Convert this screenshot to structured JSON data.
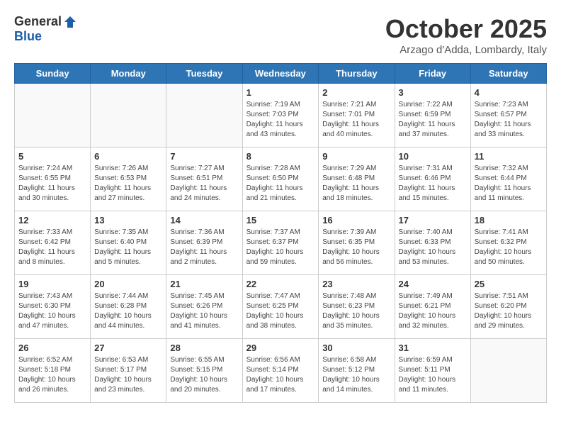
{
  "header": {
    "logo_general": "General",
    "logo_blue": "Blue",
    "month_title": "October 2025",
    "subtitle": "Arzago d'Adda, Lombardy, Italy"
  },
  "weekdays": [
    "Sunday",
    "Monday",
    "Tuesday",
    "Wednesday",
    "Thursday",
    "Friday",
    "Saturday"
  ],
  "weeks": [
    [
      {
        "day": "",
        "info": ""
      },
      {
        "day": "",
        "info": ""
      },
      {
        "day": "",
        "info": ""
      },
      {
        "day": "1",
        "info": "Sunrise: 7:19 AM\nSunset: 7:03 PM\nDaylight: 11 hours\nand 43 minutes."
      },
      {
        "day": "2",
        "info": "Sunrise: 7:21 AM\nSunset: 7:01 PM\nDaylight: 11 hours\nand 40 minutes."
      },
      {
        "day": "3",
        "info": "Sunrise: 7:22 AM\nSunset: 6:59 PM\nDaylight: 11 hours\nand 37 minutes."
      },
      {
        "day": "4",
        "info": "Sunrise: 7:23 AM\nSunset: 6:57 PM\nDaylight: 11 hours\nand 33 minutes."
      }
    ],
    [
      {
        "day": "5",
        "info": "Sunrise: 7:24 AM\nSunset: 6:55 PM\nDaylight: 11 hours\nand 30 minutes."
      },
      {
        "day": "6",
        "info": "Sunrise: 7:26 AM\nSunset: 6:53 PM\nDaylight: 11 hours\nand 27 minutes."
      },
      {
        "day": "7",
        "info": "Sunrise: 7:27 AM\nSunset: 6:51 PM\nDaylight: 11 hours\nand 24 minutes."
      },
      {
        "day": "8",
        "info": "Sunrise: 7:28 AM\nSunset: 6:50 PM\nDaylight: 11 hours\nand 21 minutes."
      },
      {
        "day": "9",
        "info": "Sunrise: 7:29 AM\nSunset: 6:48 PM\nDaylight: 11 hours\nand 18 minutes."
      },
      {
        "day": "10",
        "info": "Sunrise: 7:31 AM\nSunset: 6:46 PM\nDaylight: 11 hours\nand 15 minutes."
      },
      {
        "day": "11",
        "info": "Sunrise: 7:32 AM\nSunset: 6:44 PM\nDaylight: 11 hours\nand 11 minutes."
      }
    ],
    [
      {
        "day": "12",
        "info": "Sunrise: 7:33 AM\nSunset: 6:42 PM\nDaylight: 11 hours\nand 8 minutes."
      },
      {
        "day": "13",
        "info": "Sunrise: 7:35 AM\nSunset: 6:40 PM\nDaylight: 11 hours\nand 5 minutes."
      },
      {
        "day": "14",
        "info": "Sunrise: 7:36 AM\nSunset: 6:39 PM\nDaylight: 11 hours\nand 2 minutes."
      },
      {
        "day": "15",
        "info": "Sunrise: 7:37 AM\nSunset: 6:37 PM\nDaylight: 10 hours\nand 59 minutes."
      },
      {
        "day": "16",
        "info": "Sunrise: 7:39 AM\nSunset: 6:35 PM\nDaylight: 10 hours\nand 56 minutes."
      },
      {
        "day": "17",
        "info": "Sunrise: 7:40 AM\nSunset: 6:33 PM\nDaylight: 10 hours\nand 53 minutes."
      },
      {
        "day": "18",
        "info": "Sunrise: 7:41 AM\nSunset: 6:32 PM\nDaylight: 10 hours\nand 50 minutes."
      }
    ],
    [
      {
        "day": "19",
        "info": "Sunrise: 7:43 AM\nSunset: 6:30 PM\nDaylight: 10 hours\nand 47 minutes."
      },
      {
        "day": "20",
        "info": "Sunrise: 7:44 AM\nSunset: 6:28 PM\nDaylight: 10 hours\nand 44 minutes."
      },
      {
        "day": "21",
        "info": "Sunrise: 7:45 AM\nSunset: 6:26 PM\nDaylight: 10 hours\nand 41 minutes."
      },
      {
        "day": "22",
        "info": "Sunrise: 7:47 AM\nSunset: 6:25 PM\nDaylight: 10 hours\nand 38 minutes."
      },
      {
        "day": "23",
        "info": "Sunrise: 7:48 AM\nSunset: 6:23 PM\nDaylight: 10 hours\nand 35 minutes."
      },
      {
        "day": "24",
        "info": "Sunrise: 7:49 AM\nSunset: 6:21 PM\nDaylight: 10 hours\nand 32 minutes."
      },
      {
        "day": "25",
        "info": "Sunrise: 7:51 AM\nSunset: 6:20 PM\nDaylight: 10 hours\nand 29 minutes."
      }
    ],
    [
      {
        "day": "26",
        "info": "Sunrise: 6:52 AM\nSunset: 5:18 PM\nDaylight: 10 hours\nand 26 minutes."
      },
      {
        "day": "27",
        "info": "Sunrise: 6:53 AM\nSunset: 5:17 PM\nDaylight: 10 hours\nand 23 minutes."
      },
      {
        "day": "28",
        "info": "Sunrise: 6:55 AM\nSunset: 5:15 PM\nDaylight: 10 hours\nand 20 minutes."
      },
      {
        "day": "29",
        "info": "Sunrise: 6:56 AM\nSunset: 5:14 PM\nDaylight: 10 hours\nand 17 minutes."
      },
      {
        "day": "30",
        "info": "Sunrise: 6:58 AM\nSunset: 5:12 PM\nDaylight: 10 hours\nand 14 minutes."
      },
      {
        "day": "31",
        "info": "Sunrise: 6:59 AM\nSunset: 5:11 PM\nDaylight: 10 hours\nand 11 minutes."
      },
      {
        "day": "",
        "info": ""
      }
    ]
  ]
}
